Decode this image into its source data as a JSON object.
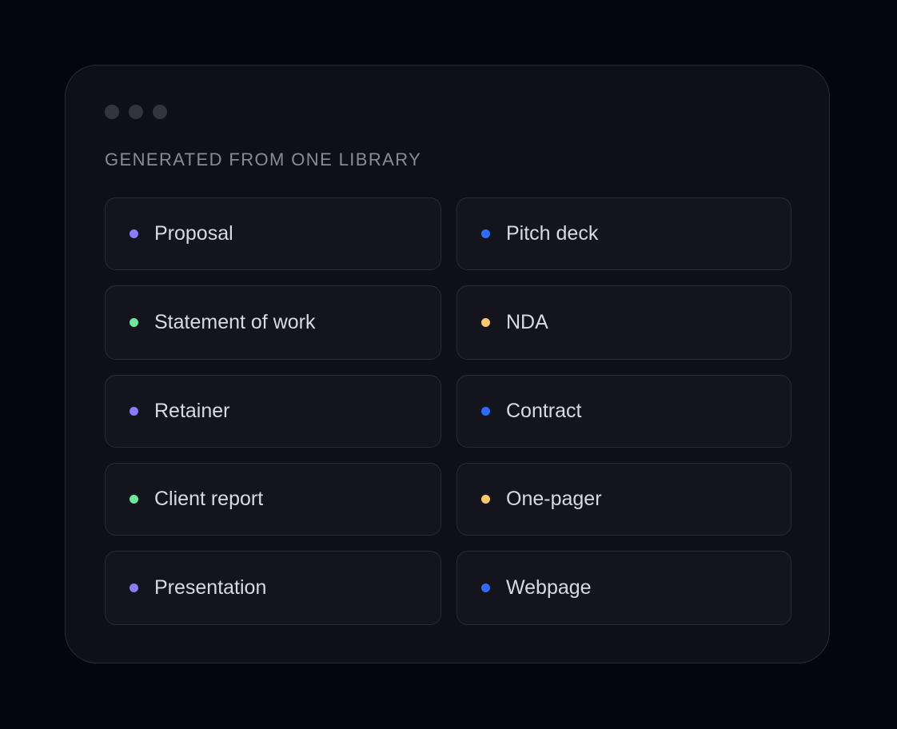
{
  "window": {
    "controls": [
      "window-dot-1",
      "window-dot-2",
      "window-dot-3"
    ]
  },
  "section": {
    "label": "GENERATED FROM ONE LIBRARY"
  },
  "colors": {
    "purple": "#8b7cf6",
    "blue": "#2f6bff",
    "green": "#6ee7a0",
    "amber": "#fcc76e"
  },
  "documents": [
    {
      "label": "Proposal",
      "color": "#8b7cf6"
    },
    {
      "label": "Pitch deck",
      "color": "#2f6bff"
    },
    {
      "label": "Statement of work",
      "color": "#6ee7a0"
    },
    {
      "label": "NDA",
      "color": "#fcc76e"
    },
    {
      "label": "Retainer",
      "color": "#8b7cf6"
    },
    {
      "label": "Contract",
      "color": "#2f6bff"
    },
    {
      "label": "Client report",
      "color": "#6ee7a0"
    },
    {
      "label": "One-pager",
      "color": "#fcc76e"
    },
    {
      "label": "Presentation",
      "color": "#8b7cf6"
    },
    {
      "label": "Webpage",
      "color": "#2f6bff"
    }
  ]
}
